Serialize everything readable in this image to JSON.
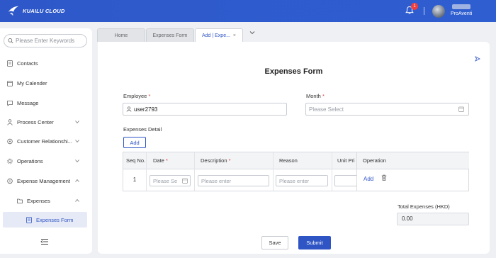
{
  "header": {
    "brand": "KUAILU CLOUD",
    "notification_count": "1",
    "company": "ProAventi",
    "accent_color": "#2f5ed1"
  },
  "sidebar": {
    "search_placeholder": "Please Enter Keywords",
    "items": [
      {
        "label": "Contacts",
        "icon": "contacts-icon"
      },
      {
        "label": "My Calender",
        "icon": "calendar-icon"
      },
      {
        "label": "Message",
        "icon": "message-icon"
      },
      {
        "label": "Process Center",
        "icon": "process-icon",
        "chevron": "down"
      },
      {
        "label": "Customer Relationshi...",
        "icon": "customer-icon",
        "chevron": "down"
      },
      {
        "label": "Operations",
        "icon": "operations-icon",
        "chevron": "down"
      },
      {
        "label": "Expense Management",
        "icon": "expense-icon",
        "chevron": "up"
      },
      {
        "label": "Expenses",
        "icon": "folder-icon",
        "chevron": "up"
      },
      {
        "label": "Expenses Form",
        "icon": "form-icon",
        "active": true
      }
    ]
  },
  "tabs": [
    {
      "label": "Home"
    },
    {
      "label": "Expenses Form"
    },
    {
      "label": "Add | Expe...",
      "active": true,
      "close": "×"
    }
  ],
  "form": {
    "title": "Expenses Form",
    "employee_label": "Employee",
    "employee_value": "user2793",
    "month_label": "Month",
    "month_placeholder": "Please Select",
    "details_label": "Expenses Detail",
    "add_label": "Add",
    "required_mark": "*"
  },
  "table": {
    "headers": {
      "seq": "Seq No.",
      "date": "Date",
      "description": "Description",
      "reason": "Reason",
      "unit_price": "Unit Pri",
      "operation": "Operation"
    },
    "row": {
      "seq": "1",
      "date_placeholder": "Please Se",
      "description_placeholder": "Please enter",
      "reason_placeholder": "Please enter",
      "op_add": "Add"
    }
  },
  "totals": {
    "label": "Total Expenses (HKD)",
    "value": "0.00"
  },
  "actions": {
    "save": "Save",
    "submit": "Submit"
  }
}
